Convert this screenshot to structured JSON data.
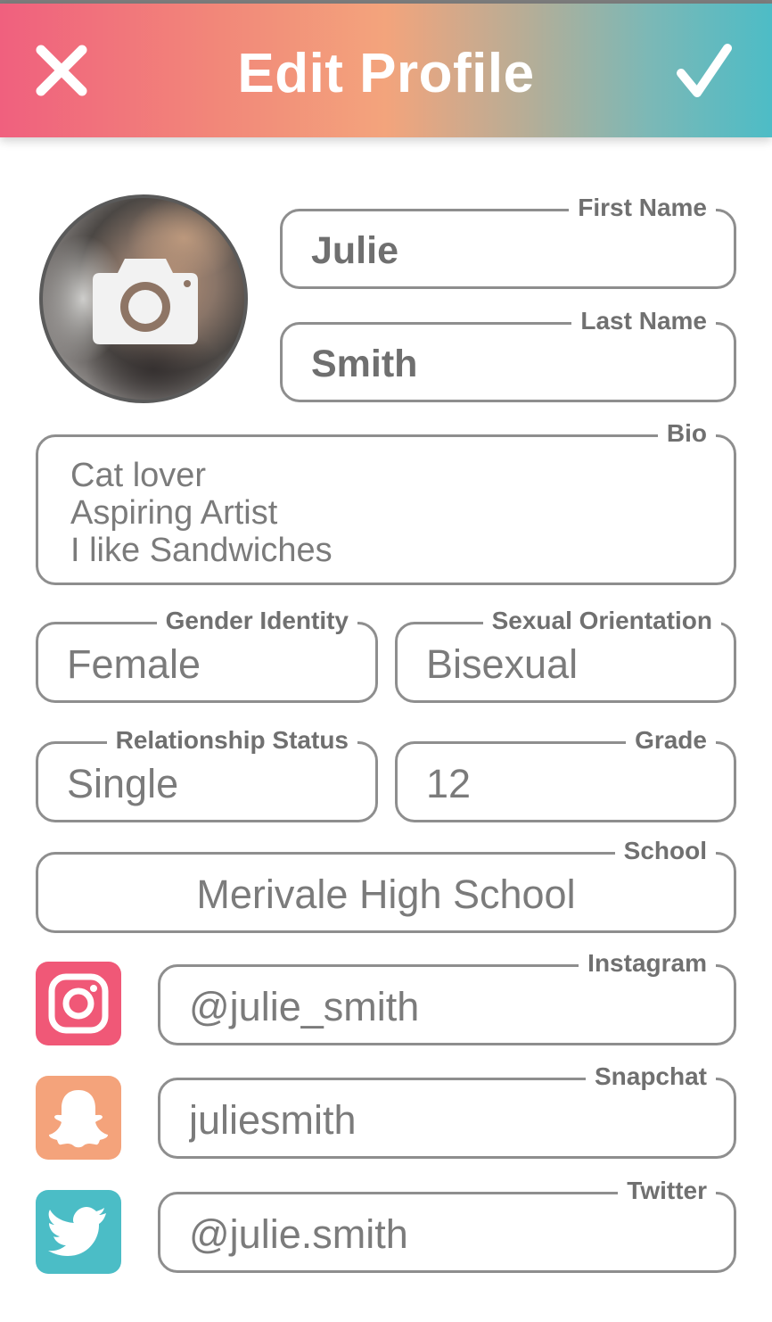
{
  "header": {
    "title": "Edit Profile",
    "close_icon": "close-icon",
    "confirm_icon": "checkmark-icon"
  },
  "avatar": {
    "icon": "camera-icon"
  },
  "fields": {
    "first_name": {
      "label": "First Name",
      "value": "Julie"
    },
    "last_name": {
      "label": "Last Name",
      "value": "Smith"
    },
    "bio": {
      "label": "Bio",
      "lines": [
        "Cat lover",
        "Aspiring Artist",
        "I like Sandwiches"
      ]
    },
    "gender": {
      "label": "Gender Identity",
      "value": "Female"
    },
    "orientation": {
      "label": "Sexual Orientation",
      "value": "Bisexual"
    },
    "relationship": {
      "label": "Relationship Status",
      "value": "Single"
    },
    "grade": {
      "label": "Grade",
      "value": "12"
    },
    "school": {
      "label": "School",
      "value": "Merivale High School"
    },
    "instagram": {
      "label": "Instagram",
      "value": "@julie_smith"
    },
    "snapchat": {
      "label": "Snapchat",
      "value": "juliesmith"
    },
    "twitter": {
      "label": "Twitter",
      "value": "@julie.smith"
    }
  },
  "colors": {
    "instagram": "#f05877",
    "snapchat": "#f4a37b",
    "twitter": "#4bbdc6",
    "border": "#8e8e8e"
  }
}
